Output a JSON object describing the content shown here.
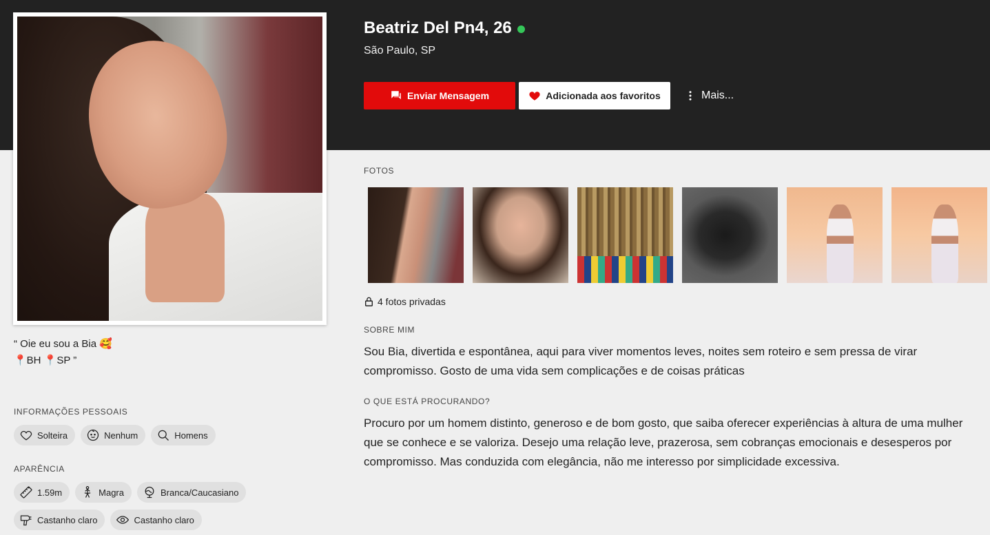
{
  "profile": {
    "name_age": "Beatriz Del Pn4, 26",
    "online_color": "#35c759",
    "location": "São Paulo, SP",
    "quote_line1": "“ Oie eu sou a Bia 🥰",
    "quote_line2": "📍BH 📍SP ”"
  },
  "actions": {
    "message_label": "Enviar Mensagem",
    "favorite_label": "Adicionada aos favoritos",
    "more_label": "Mais..."
  },
  "colors": {
    "header_bg": "#222222",
    "primary_red": "#e20b0b",
    "page_bg": "#efefef"
  },
  "personal": {
    "label": "INFORMAÇÕES PESSOAIS",
    "chips": [
      {
        "icon": "heart-icon",
        "label": "Solteira"
      },
      {
        "icon": "baby-face-icon",
        "label": "Nenhum"
      },
      {
        "icon": "search-icon",
        "label": "Homens"
      }
    ]
  },
  "appearance": {
    "label": "APARÊNCIA",
    "chips": [
      {
        "icon": "ruler-icon",
        "label": "1.59m"
      },
      {
        "icon": "body-icon",
        "label": "Magra"
      },
      {
        "icon": "globe-icon",
        "label": "Branca/Caucasiano"
      },
      {
        "icon": "hair-dryer-icon",
        "label": "Castanho claro"
      },
      {
        "icon": "eye-icon",
        "label": "Castanho claro"
      }
    ]
  },
  "photos": {
    "label": "FOTOS",
    "count": 6,
    "private_label": "4 fotos privadas"
  },
  "about": {
    "label": "SOBRE MIM",
    "text": "Sou Bia, divertida e espontânea, aqui para viver momentos leves, noites sem roteiro e sem pressa de virar compromisso. Gosto de uma vida sem complicações e de coisas práticas"
  },
  "looking": {
    "label": "O QUE ESTÁ PROCURANDO?",
    "text": "Procuro por um homem distinto, generoso e de bom gosto, que saiba oferecer experiências à altura de uma mulher que se conhece e se valoriza. Desejo uma relação leve, prazerosa, sem cobranças emocionais e desesperos por compromisso. Mas conduzida com elegância, não me interesso por simplicidade excessiva."
  }
}
